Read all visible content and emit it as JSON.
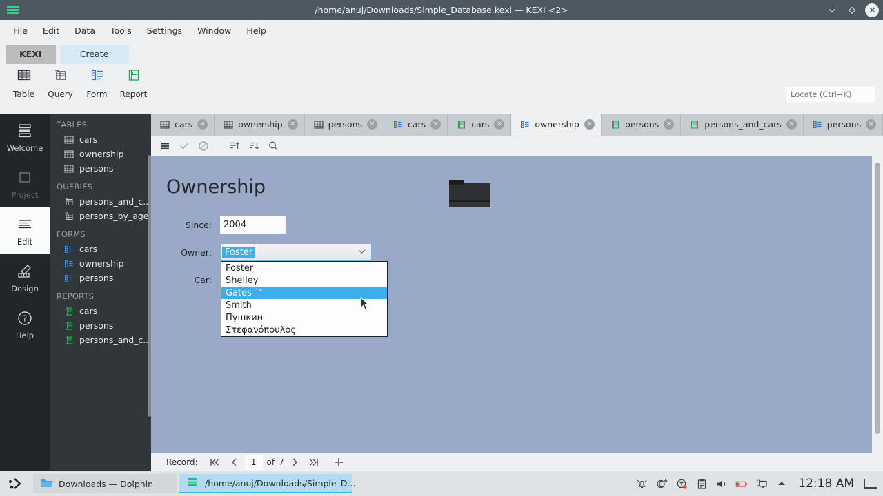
{
  "titlebar": {
    "title": "/home/anuj/Downloads/Simple_Database.kexi — KEXI <2>",
    "minimize_icon": "chevron-down-icon",
    "maximize_icon": "diamond-icon",
    "close_icon": "close-icon"
  },
  "menubar": {
    "items": [
      {
        "label": "File"
      },
      {
        "label": "Edit"
      },
      {
        "label": "Data"
      },
      {
        "label": "Tools"
      },
      {
        "label": "Settings"
      },
      {
        "label": "Window"
      },
      {
        "label": "Help"
      }
    ]
  },
  "ribbon": {
    "tabs": [
      {
        "label": "KEXI",
        "active": false
      },
      {
        "label": "Create",
        "active": true
      }
    ],
    "actions": [
      {
        "label": "Table",
        "icon": "table-icon"
      },
      {
        "label": "Query",
        "icon": "query-icon"
      },
      {
        "label": "Form",
        "icon": "form-icon"
      },
      {
        "label": "Report",
        "icon": "report-icon"
      }
    ],
    "locate": {
      "placeholder": "Locate (Ctrl+K)",
      "value": ""
    }
  },
  "rail": {
    "items": [
      {
        "label": "Welcome",
        "icon": "welcome-icon",
        "state": "normal"
      },
      {
        "label": "Project",
        "icon": "project-icon",
        "state": "disabled"
      },
      {
        "label": "Edit",
        "icon": "edit-icon",
        "state": "active"
      },
      {
        "label": "Design",
        "icon": "design-icon",
        "state": "normal"
      },
      {
        "label": "Help",
        "icon": "help-icon",
        "state": "normal"
      }
    ]
  },
  "navigator": {
    "groups": [
      {
        "title": "TABLES",
        "icon": "table-icon",
        "items": [
          {
            "label": "cars"
          },
          {
            "label": "ownership"
          },
          {
            "label": "persons"
          }
        ]
      },
      {
        "title": "QUERIES",
        "icon": "query-icon",
        "items": [
          {
            "label": "persons_and_c..."
          },
          {
            "label": "persons_by_age"
          }
        ]
      },
      {
        "title": "FORMS",
        "icon": "form-icon",
        "items": [
          {
            "label": "cars"
          },
          {
            "label": "ownership"
          },
          {
            "label": "persons"
          }
        ]
      },
      {
        "title": "REPORTS",
        "icon": "report-icon",
        "items": [
          {
            "label": "cars"
          },
          {
            "label": "persons"
          },
          {
            "label": "persons_and_c..."
          }
        ]
      }
    ]
  },
  "document_tabs": [
    {
      "label": "cars",
      "icon": "table-icon",
      "active": false
    },
    {
      "label": "ownership",
      "icon": "table-icon",
      "active": false
    },
    {
      "label": "persons",
      "icon": "table-icon",
      "active": false
    },
    {
      "label": "cars",
      "icon": "form-icon",
      "active": false
    },
    {
      "label": "cars",
      "icon": "report-icon",
      "active": false
    },
    {
      "label": "ownership",
      "icon": "form-icon",
      "active": true
    },
    {
      "label": "persons",
      "icon": "report-icon",
      "active": false
    },
    {
      "label": "persons_and_cars",
      "icon": "report-icon",
      "active": false
    },
    {
      "label": "persons",
      "icon": "form-icon",
      "active": false
    }
  ],
  "form_toolbar": {
    "buttons": [
      {
        "icon": "hamburger-menu-icon",
        "name": "menu-button"
      },
      {
        "icon": "check-icon",
        "name": "accept-changes-button"
      },
      {
        "icon": "cancel-icon",
        "name": "cancel-changes-button"
      },
      {
        "icon": "sort-ascending-icon",
        "name": "sort-ascending-button"
      },
      {
        "icon": "sort-descending-icon",
        "name": "sort-descending-button"
      },
      {
        "icon": "search-icon",
        "name": "find-button"
      }
    ]
  },
  "form": {
    "title": "Ownership",
    "image_icon": "folder-image",
    "fields": [
      {
        "label": "Since:",
        "value": "2004",
        "type": "text"
      },
      {
        "label": "Owner:",
        "value": "Foster",
        "type": "combobox"
      },
      {
        "label": "Car:",
        "value": "",
        "type": "combobox"
      }
    ],
    "dropdown": {
      "open": true,
      "options": [
        {
          "label": "Foster",
          "selected": false
        },
        {
          "label": "Shelley",
          "selected": false
        },
        {
          "label": "Gates ™",
          "selected": true
        },
        {
          "label": "Smith",
          "selected": false
        },
        {
          "label": "Пушкин",
          "selected": false
        },
        {
          "label": "Στεφανόπουλος",
          "selected": false
        }
      ]
    }
  },
  "record_nav": {
    "label": "Record:",
    "first_icon": "go-first-icon",
    "prev_icon": "go-previous-icon",
    "current": "1",
    "of_label": "of",
    "total": "7",
    "next_icon": "go-next-icon",
    "last_icon": "go-last-icon",
    "add_icon": "plus-icon"
  },
  "taskbar": {
    "launcher_icon": "kickoff-icon",
    "tasks": [
      {
        "label": "Downloads — Dolphin",
        "icon": "folder-icon",
        "active": false
      },
      {
        "label": "/home/anuj/Downloads/Simple_D...",
        "icon": "kexi-icon",
        "active": true
      }
    ],
    "tray": [
      {
        "icon": "notifications-muted-icon"
      },
      {
        "icon": "network-icon"
      },
      {
        "icon": "updates-icon"
      },
      {
        "icon": "clipboard-icon"
      },
      {
        "icon": "volume-icon"
      },
      {
        "icon": "battery-low-icon"
      },
      {
        "icon": "display-icon"
      },
      {
        "icon": "show-hidden-icon"
      }
    ],
    "clock": "12:18 AM",
    "peek_icon": "show-desktop-icon"
  },
  "colors": {
    "titlebar": "#4d5860",
    "accent": "#3daee9",
    "form_background": "#9aa9c8",
    "rail_background": "#232629",
    "navigator_background": "#31363b",
    "chrome": "#eff0f1",
    "kexi_green": "#3bcd93",
    "battery_red": "#e8413c"
  }
}
